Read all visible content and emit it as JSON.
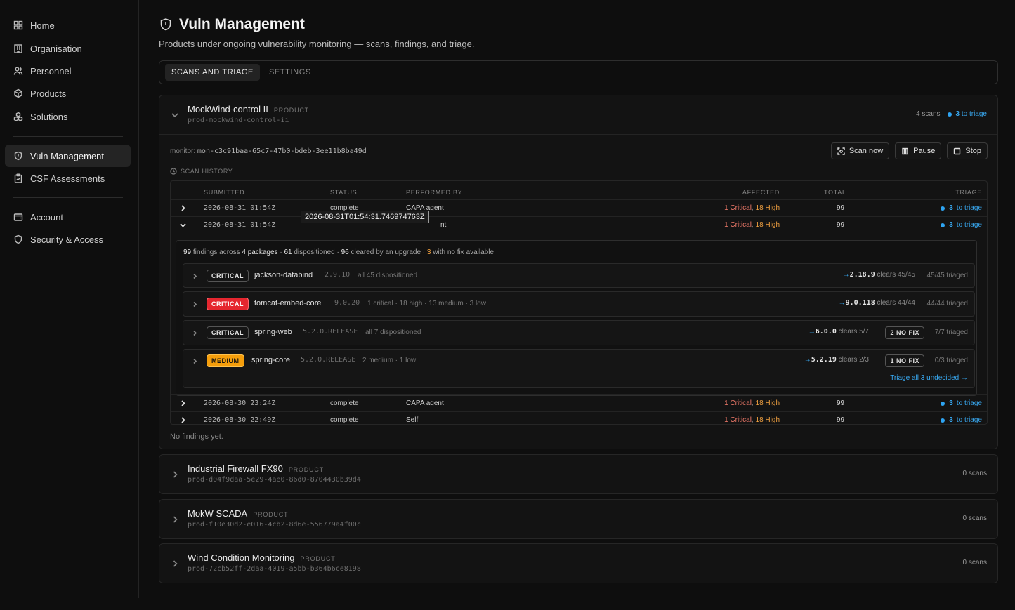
{
  "sidebar": {
    "items": [
      {
        "label": "Home",
        "icon": "grid-icon"
      },
      {
        "label": "Organisation",
        "icon": "building-icon"
      },
      {
        "label": "Personnel",
        "icon": "users-icon"
      },
      {
        "label": "Products",
        "icon": "box-icon"
      },
      {
        "label": "Solutions",
        "icon": "boxes-icon"
      },
      {
        "label": "Vuln Management",
        "icon": "shield-icon",
        "active": true
      },
      {
        "label": "CSF Assessments",
        "icon": "clipboard-icon"
      },
      {
        "label": "Account",
        "icon": "wallet-icon"
      },
      {
        "label": "Security & Access",
        "icon": "shield-icon"
      }
    ]
  },
  "page": {
    "title": "Vuln Management",
    "subtitle": "Products under ongoing vulnerability monitoring — scans, findings, and triage."
  },
  "tabs": [
    {
      "label": "SCANS AND TRIAGE",
      "active": true
    },
    {
      "label": "SETTINGS",
      "active": false
    }
  ],
  "product1": {
    "name": "MockWind-control II",
    "tag": "PRODUCT",
    "id": "prod-mockwind-control-ii",
    "scans": "4 scans",
    "triage_count": "3",
    "triage_label": "to triage",
    "monitor_label": "monitor:",
    "monitor_id": "mon-c3c91baa-65c7-47b0-bdeb-3ee11b8ba49d",
    "buttons": {
      "scan": "Scan now",
      "pause": "Pause",
      "stop": "Stop"
    },
    "history_label": "SCAN HISTORY",
    "columns": {
      "submitted": "SUBMITTED",
      "status": "STATUS",
      "performed": "PERFORMED BY",
      "affected": "AFFECTED",
      "total": "TOTAL",
      "triage": "TRIAGE"
    },
    "rows": [
      {
        "submitted": "2026-08-31 01:54Z",
        "status": "complete",
        "performed": "CAPA agent",
        "critical": "1 Critical",
        "high": "18 High",
        "total": "99",
        "triage": "3",
        "triage_label": "to triage"
      },
      {
        "submitted": "2026-08-31 01:54Z",
        "status": "",
        "performed": "nt",
        "critical": "1 Critical",
        "high": "18 High",
        "total": "99",
        "triage": "3",
        "triage_label": "to triage"
      },
      {
        "submitted": "2026-08-30 23:24Z",
        "status": "complete",
        "performed": "CAPA agent",
        "critical": "1 Critical",
        "high": "18 High",
        "total": "99",
        "triage": "3",
        "triage_label": "to triage"
      },
      {
        "submitted": "2026-08-30 22:49Z",
        "status": "complete",
        "performed": "Self",
        "critical": "1 Critical",
        "high": "18 High",
        "total": "99",
        "triage": "3",
        "triage_label": "to triage"
      }
    ],
    "tooltip": "2026-08-31T01:54:31.746974763Z",
    "summary": {
      "findings": "99",
      "t1": " findings across ",
      "packages": "4 packages",
      "t2": " · ",
      "dispositioned": "61",
      "t3": " dispositioned · ",
      "cleared": "96",
      "t4": " cleared by an upgrade · ",
      "nofix": "3",
      "t5": " with no fix available"
    },
    "packages": [
      {
        "severity": "CRITICAL",
        "name": "jackson-databind",
        "version": "2.9.10",
        "note": "all 45 dispositioned",
        "fix": "2.18.9",
        "clears": "clears 45/45",
        "nofix": "",
        "triaged": "45/45 triaged"
      },
      {
        "severity": "CRITICAL",
        "name": "tomcat-embed-core",
        "version": "9.0.20",
        "note": "1 critical · 18 high · 13 medium · 3 low",
        "fix": "9.0.118",
        "clears": "clears 44/44",
        "nofix": "",
        "triaged": "44/44 triaged"
      },
      {
        "severity": "CRITICAL",
        "name": "spring-web",
        "version": "5.2.0.RELEASE",
        "note": "all 7 dispositioned",
        "fix": "6.0.0",
        "clears": "clears 5/7",
        "nofix": "2 NO FIX",
        "triaged": "7/7 triaged"
      },
      {
        "severity": "MEDIUM",
        "name": "spring-core",
        "version": "5.2.0.RELEASE",
        "note": "2 medium · 1 low",
        "fix": "5.2.19",
        "clears": "clears 2/3",
        "nofix": "1 NO FIX",
        "triaged": "0/3 triaged",
        "action": "Triage all 3 undecided →"
      }
    ],
    "no_findings": "No findings yet."
  },
  "products": [
    {
      "name": "Industrial Firewall FX90",
      "tag": "PRODUCT",
      "id": "prod-d04f9daa-5e29-4ae0-86d0-8704430b39d4",
      "scans": "0 scans"
    },
    {
      "name": "MokW SCADA",
      "tag": "PRODUCT",
      "id": "prod-f10e30d2-e016-4cb2-8d6e-556779a4f00c",
      "scans": "0 scans"
    },
    {
      "name": "Wind Condition Monitoring",
      "tag": "PRODUCT",
      "id": "prod-72cb52ff-2daa-4019-a5bb-b364b6ce8198",
      "scans": "0 scans"
    }
  ],
  "colors": {
    "accent": "#38a8f0",
    "critical": "#e5262f",
    "medium": "#f59e0b",
    "critical_text": "#f07a6a",
    "high_text": "#f0a040"
  }
}
